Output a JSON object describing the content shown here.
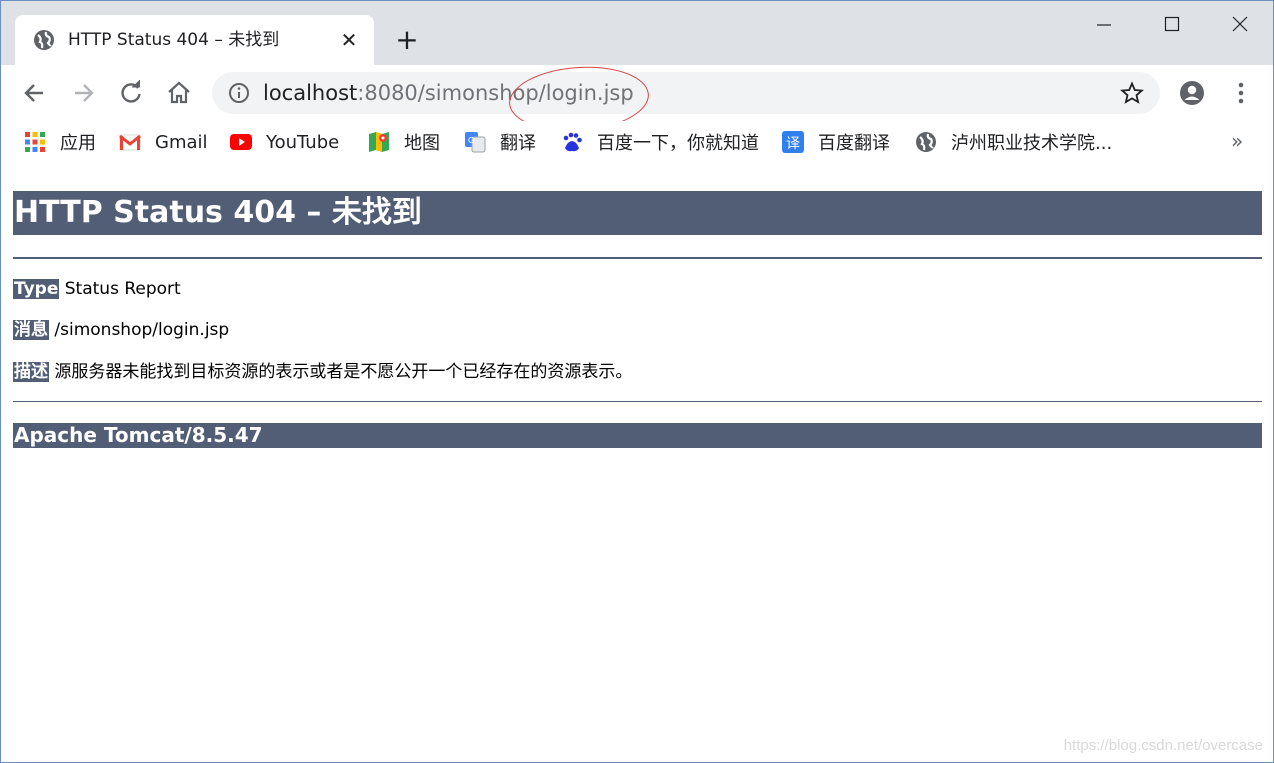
{
  "browser": {
    "tab": {
      "title": "HTTP Status 404 – 未找到",
      "close_icon": "close-icon",
      "favicon": "globe-icon"
    },
    "new_tab_icon": "plus-icon",
    "window_controls": [
      "minimize-icon",
      "maximize-icon",
      "close-icon"
    ],
    "toolbar": {
      "back_icon": "arrow-left-icon",
      "forward_icon": "arrow-right-icon",
      "reload_icon": "reload-icon",
      "home_icon": "home-icon",
      "url_host": "localhost",
      "url_rest": ":8080/simonshop/login.jsp",
      "star_icon": "star-icon",
      "profile_icon": "account-icon",
      "menu_icon": "kebab-menu-icon"
    },
    "bookmarks": [
      {
        "label": "应用",
        "icon": "apps-grid-icon"
      },
      {
        "label": "Gmail",
        "icon": "gmail-icon"
      },
      {
        "label": "YouTube",
        "icon": "youtube-icon"
      },
      {
        "label": "地图",
        "icon": "maps-icon"
      },
      {
        "label": "翻译",
        "icon": "translate-icon"
      },
      {
        "label": "百度一下，你就知道",
        "icon": "baidu-icon"
      },
      {
        "label": "百度翻译",
        "icon": "baidu-translate-icon"
      },
      {
        "label": "泸州职业技术学院...",
        "icon": "globe-icon"
      }
    ],
    "bookmarks_overflow": "»"
  },
  "page": {
    "heading": "HTTP Status 404 – 未找到",
    "type_label": "Type",
    "type_value": "Status Report",
    "message_label": "消息",
    "message_value": "/simonshop/login.jsp",
    "description_label": "描述",
    "description_value": "源服务器未能找到目标资源的表示或者是不愿公开一个已经存在的资源表示。",
    "footer": "Apache Tomcat/8.5.47"
  },
  "watermark": "https://blog.csdn.net/overcase",
  "colors": {
    "tomcat_header": "#525d76",
    "tab_strip": "#dee1e6",
    "omnibox": "#f1f3f4",
    "annotation_circle": "#d64545"
  }
}
